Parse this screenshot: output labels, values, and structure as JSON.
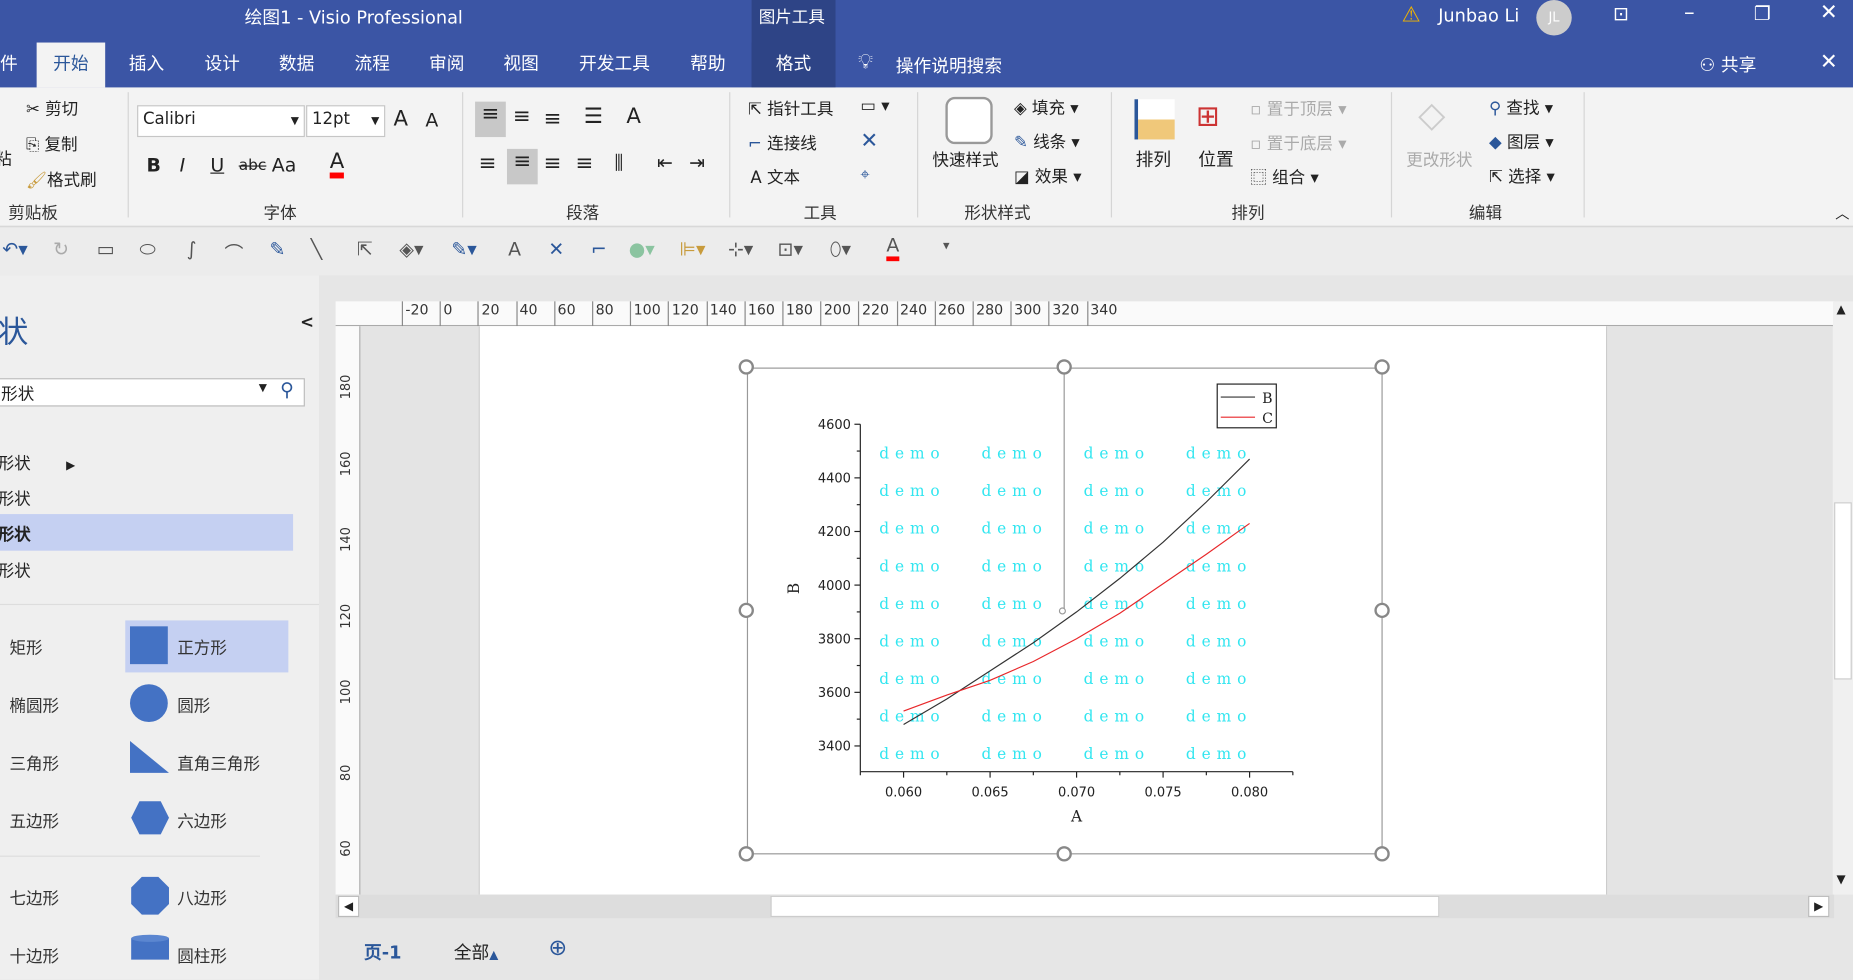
{
  "title": {
    "doc": "绘图1  -  Visio Professional",
    "context": "图片工具",
    "user": "Junbao Li",
    "initials": "JL",
    "warning_icon": "warning-icon"
  },
  "tabs": [
    "件",
    "开始",
    "插入",
    "设计",
    "数据",
    "流程",
    "审阅",
    "视图",
    "开发工具",
    "帮助",
    "格式"
  ],
  "search": "操作说明搜索",
  "share": "共享",
  "clipboard": {
    "cut": "剪切",
    "copy": "复制",
    "painter": "格式刷",
    "paste": "粘",
    "group": "剪贴板"
  },
  "font": {
    "name": "Calibri",
    "size": "12pt",
    "group": "字体",
    "bold": "B",
    "italic": "I",
    "underline": "U",
    "strike": "abc",
    "case": "Aa",
    "color_letter": "A",
    "color": "#ff0000",
    "grow": "A",
    "shrink": "A"
  },
  "paragraph": {
    "group": "段落"
  },
  "tools": {
    "pointer": "指针工具",
    "connector": "连接线",
    "text": "文本",
    "group": "工具"
  },
  "shape_style": {
    "quick": "快速样式",
    "fill": "填充",
    "line": "线条",
    "effects": "效果",
    "group": "形状样式"
  },
  "arrange": {
    "arrange": "排列",
    "position": "位置",
    "front": "置于顶层",
    "back": "置于底层",
    "group_btn": "组合",
    "group": "排列"
  },
  "editing": {
    "change": "更改形状",
    "find": "查找",
    "layers": "图层",
    "select": "选择",
    "group": "编辑"
  },
  "panel": {
    "title": "状",
    "search_value": "形状",
    "categories": [
      "形状",
      "形状",
      "形状",
      "形状"
    ],
    "shapes": [
      {
        "name": "矩形"
      },
      {
        "name": "正方形"
      },
      {
        "name": "椭圆形"
      },
      {
        "name": "圆形"
      },
      {
        "name": "三角形"
      },
      {
        "name": "直角三角形"
      },
      {
        "name": "五边形"
      },
      {
        "name": "六边形"
      },
      {
        "name": "七边形"
      },
      {
        "name": "八边形"
      },
      {
        "name": "十边形"
      },
      {
        "name": "圆柱形"
      }
    ],
    "shape_color": "#4472c4",
    "highlight": "#c5d0f2"
  },
  "ruler": {
    "h": [
      "-20",
      "0",
      "20",
      "40",
      "60",
      "80",
      "100",
      "120",
      "140",
      "160",
      "180",
      "200",
      "220",
      "240",
      "260",
      "280",
      "300",
      "320",
      "340"
    ],
    "v": [
      "180",
      "160",
      "140",
      "120",
      "100",
      "80",
      "60"
    ]
  },
  "footer": {
    "page": "页-1",
    "all": "全部"
  },
  "chart_data": {
    "type": "line",
    "xlabel": "A",
    "ylabel": "B",
    "xlim": [
      0.0575,
      0.0825
    ],
    "ylim": [
      3304,
      4600
    ],
    "xticks": [
      "0.060",
      "0.065",
      "0.070",
      "0.075",
      "0.080"
    ],
    "xtick_values": [
      0.06,
      0.065,
      0.07,
      0.075,
      0.08
    ],
    "yticks": [
      "3400",
      "3600",
      "3800",
      "4000",
      "4200",
      "4400",
      "4600"
    ],
    "ytick_values": [
      3400,
      3600,
      3800,
      4000,
      4200,
      4400,
      4600
    ],
    "legend_position": "top-right",
    "watermark": "demo",
    "series": [
      {
        "name": "B",
        "color": "#333333",
        "x": [
          0.06,
          0.0625,
          0.065,
          0.0675,
          0.07,
          0.0725,
          0.075,
          0.0775,
          0.08
        ],
        "y": [
          3480,
          3575,
          3680,
          3785,
          3900,
          4025,
          4160,
          4310,
          4470
        ]
      },
      {
        "name": "C",
        "color": "#e8272a",
        "x": [
          0.06,
          0.0625,
          0.065,
          0.0675,
          0.07,
          0.0725,
          0.075,
          0.0775,
          0.08
        ],
        "y": [
          3530,
          3590,
          3645,
          3715,
          3800,
          3895,
          4005,
          4115,
          4230
        ]
      }
    ]
  }
}
